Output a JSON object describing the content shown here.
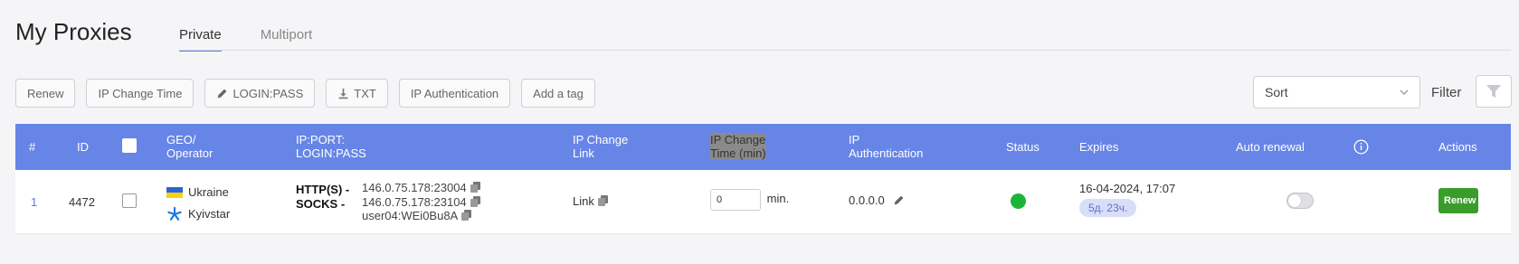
{
  "page": {
    "title": "My Proxies"
  },
  "tabs": [
    {
      "label": "Private"
    },
    {
      "label": "Multiport"
    }
  ],
  "toolbar": {
    "renew": "Renew",
    "ip_change_time": "IP Change Time",
    "login_pass": "LOGIN:PASS",
    "txt": "TXT",
    "ip_auth": "IP Authentication",
    "add_tag": "Add a tag"
  },
  "sort": {
    "value": "Sort"
  },
  "filter": {
    "label": "Filter"
  },
  "colors": {
    "header": "#6785e6",
    "status_active": "#19b539",
    "renew_button": "#3a9d2b",
    "accent": "#5b7be6"
  },
  "table": {
    "headers": {
      "num": "#",
      "id": "ID",
      "geo_line1": "GEO/",
      "geo_line2": "Operator",
      "ip_line1": "IP:PORT:",
      "ip_line2": "LOGIN:PASS",
      "link_line1": "IP Change",
      "link_line2": "Link",
      "time_line1": "IP Change",
      "time_line2": "Time (min)",
      "auth_line1": "IP",
      "auth_line2": "Authentication",
      "status": "Status",
      "expires": "Expires",
      "auto_renewal": "Auto renewal",
      "actions": "Actions"
    },
    "rows": [
      {
        "num": "1",
        "id": "4472",
        "country": "Ukraine",
        "operator": "Kyivstar",
        "proto_http": "HTTP(S) -",
        "proto_socks": "SOCKS -",
        "http_addr": "146.0.75.178:23004",
        "socks_addr": "146.0.75.178:23104",
        "credentials": "user04:WEi0Bu8A",
        "link": "Link",
        "change_time": "0",
        "change_unit": "min.",
        "ip_auth": "0.0.0.0",
        "expires_date": "16-04-2024, 17:07",
        "expires_left": "5д. 23ч.",
        "auto_renewal": false,
        "action": "Renew"
      }
    ]
  }
}
